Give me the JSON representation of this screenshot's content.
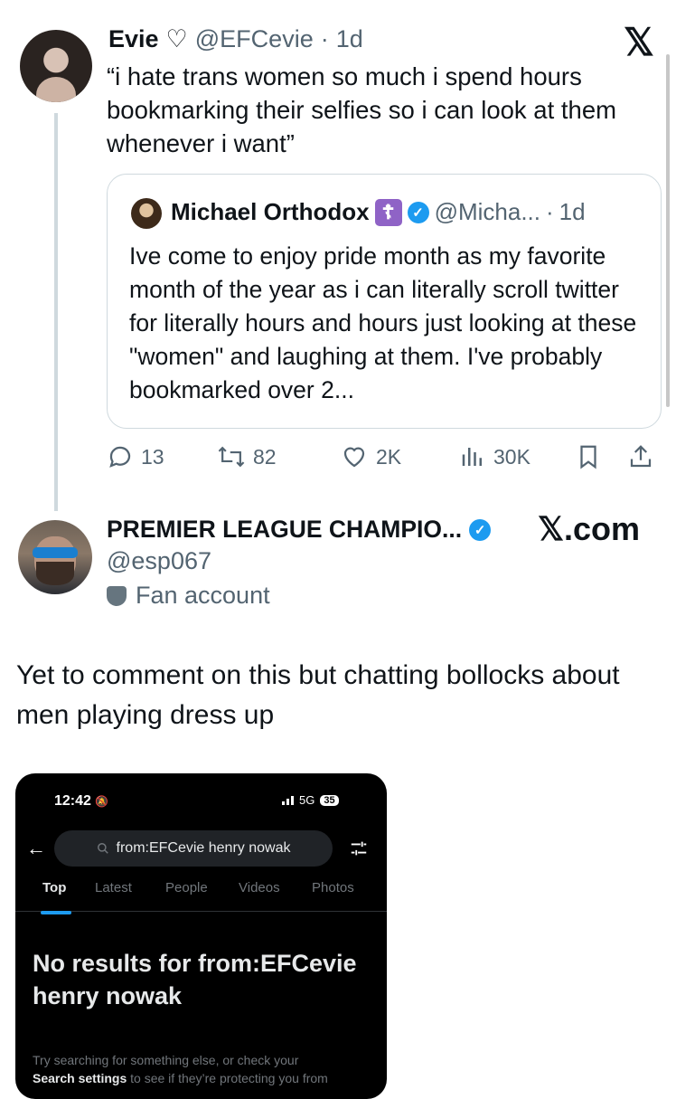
{
  "tweet1": {
    "name": "Evie",
    "heart": "♡",
    "handle": "@EFCevie",
    "sep": "·",
    "time": "1d",
    "text": "“i hate trans women so much i spend hours bookmarking their selfies so i can look at them whenever i want”"
  },
  "x_logo": "𝕏",
  "quote": {
    "name": "Michael Orthodox",
    "cross": "☦",
    "verified": "✓",
    "handle": "@Micha...",
    "sep": "·",
    "time": "1d",
    "text": "Ive come to enjoy pride month as my favorite month of the year as i can literally scroll twitter for literally hours and hours just looking at these \"women\" and laughing at them. I've probably bookmarked over 2..."
  },
  "actions": {
    "replies": "13",
    "reposts": "82",
    "likes": "2K",
    "views": "30K"
  },
  "tweet2": {
    "name": "PREMIER LEAGUE CHAMPIO...",
    "verified": "✓",
    "xcom": "𝕏.com",
    "handle": "@esp067",
    "label": "Fan account",
    "text": "Yet to comment on this but chatting bollocks about men playing dress up"
  },
  "screenshot": {
    "time": "12:42",
    "network": "5G",
    "battery": "35",
    "query": "from:EFCevie henry nowak",
    "tabs": [
      "Top",
      "Latest",
      "People",
      "Videos",
      "Photos"
    ],
    "no_results": "No results for from:EFCevie henry nowak",
    "hint_pre": "Try searching for something else, or check your",
    "hint_link": "Search settings",
    "hint_post": "to see if they’re protecting you from"
  },
  "colors": {
    "accent": "#1d9bf0",
    "muted": "#536471",
    "border": "#cfd9de",
    "badge_purple": "#8f63c6"
  },
  "icons": [
    "reply-icon",
    "repost-icon",
    "like-icon",
    "views-icon",
    "bookmark-icon",
    "share-icon",
    "search-icon",
    "filter-icon",
    "back-arrow-icon",
    "mute-icon"
  ]
}
